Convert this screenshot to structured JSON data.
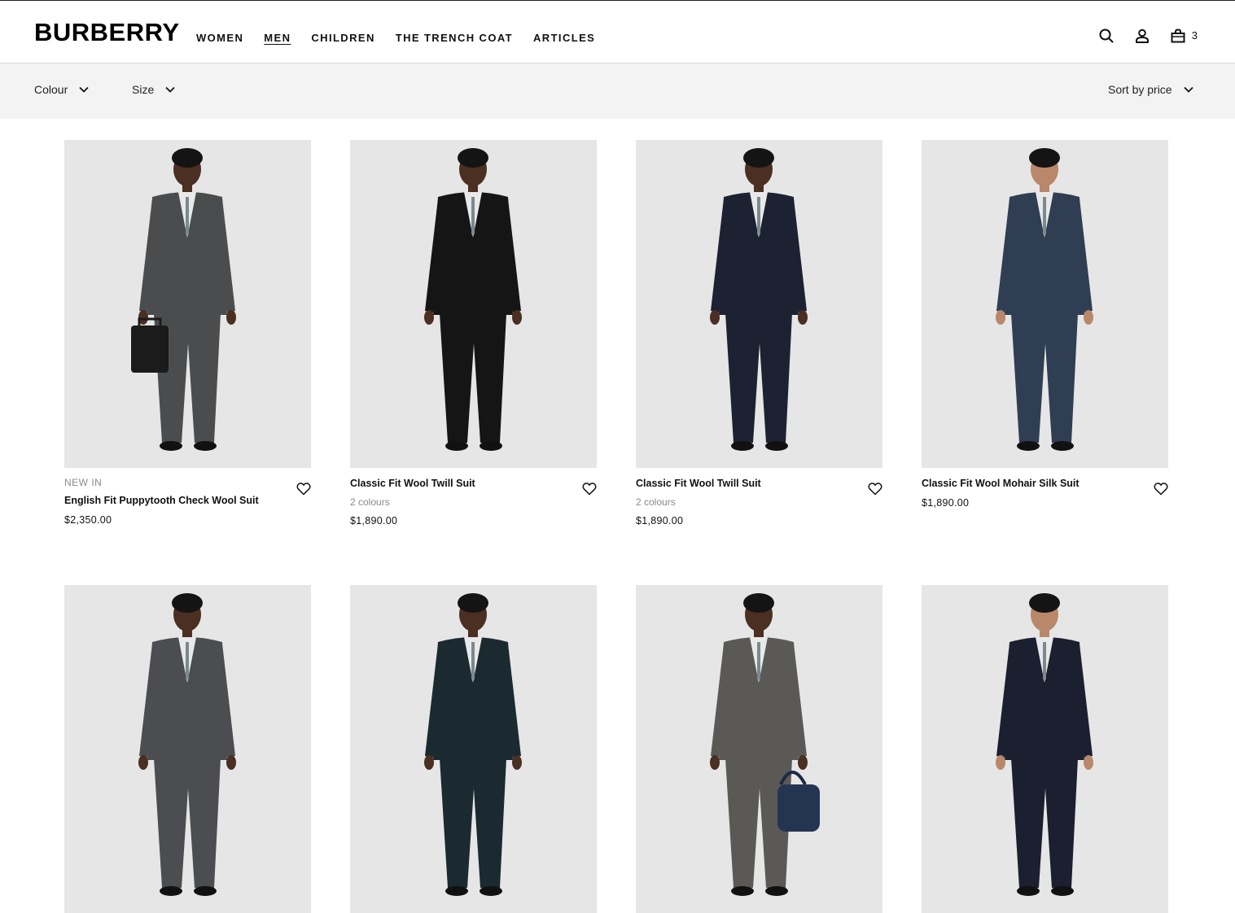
{
  "brand": {
    "logo": "BURBERRY"
  },
  "nav": {
    "items": [
      {
        "label": "WOMEN",
        "active": false
      },
      {
        "label": "MEN",
        "active": true
      },
      {
        "label": "CHILDREN",
        "active": false
      },
      {
        "label": "THE TRENCH COAT",
        "active": false
      },
      {
        "label": "ARTICLES",
        "active": false
      }
    ]
  },
  "header_icons": {
    "search": "search-icon",
    "account": "account-icon",
    "bag": "bag-icon",
    "bag_count": "3"
  },
  "filters": {
    "colour_label": "Colour",
    "size_label": "Size",
    "sort_label": "Sort by price"
  },
  "colors": {
    "filter_bar_bg": "#f3f3f3",
    "image_bg": "#e6e6e6",
    "muted_text": "#8a8a8a"
  },
  "products": [
    {
      "badge": "NEW IN",
      "name": "English Fit Puppytooth Check Wool Suit",
      "colours": "",
      "price": "$2,350.00",
      "suit_color": "#4a4c4e",
      "accessory": "briefcase"
    },
    {
      "badge": "",
      "name": "Classic Fit Wool Twill Suit",
      "colours": "2 colours",
      "price": "$1,890.00",
      "suit_color": "#151515",
      "accessory": ""
    },
    {
      "badge": "",
      "name": "Classic Fit Wool Twill Suit",
      "colours": "2 colours",
      "price": "$1,890.00",
      "suit_color": "#1d2233",
      "accessory": ""
    },
    {
      "badge": "",
      "name": "Classic Fit Wool Mohair Silk Suit",
      "colours": "",
      "price": "$1,890.00",
      "suit_color": "#2f3e52",
      "accessory": ""
    },
    {
      "badge": "",
      "name": "",
      "colours": "",
      "price": "",
      "suit_color": "#4b4d50",
      "accessory": ""
    },
    {
      "badge": "",
      "name": "",
      "colours": "",
      "price": "",
      "suit_color": "#1a2a30",
      "accessory": ""
    },
    {
      "badge": "",
      "name": "",
      "colours": "",
      "price": "",
      "suit_color": "#5b5956",
      "accessory": "holdall"
    },
    {
      "badge": "",
      "name": "",
      "colours": "",
      "price": "",
      "suit_color": "#1b1f30",
      "accessory": ""
    }
  ]
}
